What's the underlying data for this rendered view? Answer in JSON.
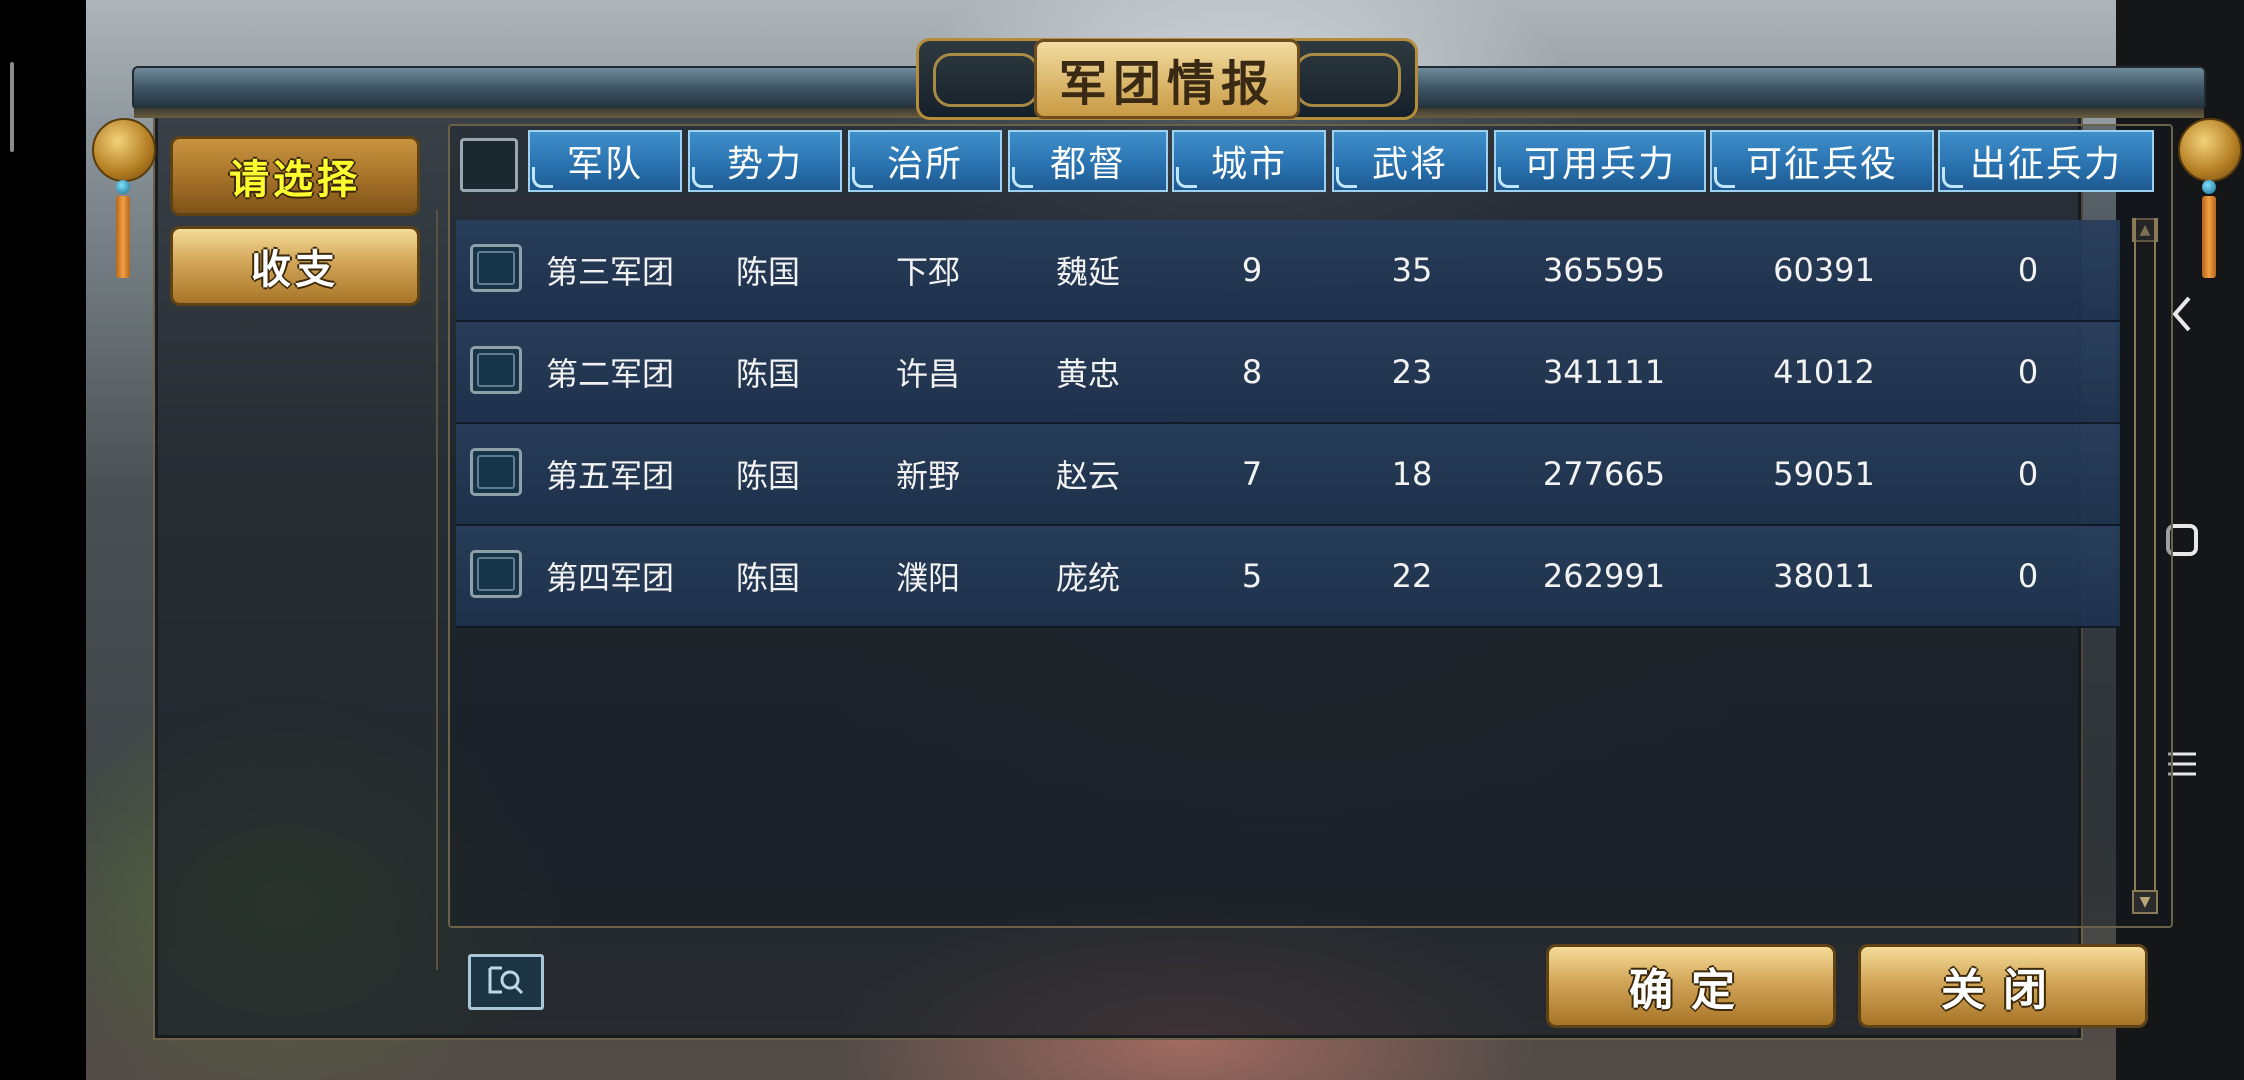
{
  "window": {
    "title": "军团情报"
  },
  "sidebar": {
    "items": [
      {
        "label": "请选择",
        "active": true
      },
      {
        "label": "收支",
        "active": false
      }
    ]
  },
  "table": {
    "columns": [
      "军队",
      "势力",
      "治所",
      "都督",
      "城市",
      "武将",
      "可用兵力",
      "可征兵役",
      "出征兵力"
    ],
    "rows": [
      {
        "army": "第三军团",
        "faction": "陈国",
        "seat": "下邳",
        "commander": "魏延",
        "cities": "9",
        "generals": "35",
        "available": "365595",
        "conscript": "60391",
        "deployed": "0"
      },
      {
        "army": "第二军团",
        "faction": "陈国",
        "seat": "许昌",
        "commander": "黄忠",
        "cities": "8",
        "generals": "23",
        "available": "341111",
        "conscript": "41012",
        "deployed": "0"
      },
      {
        "army": "第五军团",
        "faction": "陈国",
        "seat": "新野",
        "commander": "赵云",
        "cities": "7",
        "generals": "18",
        "available": "277665",
        "conscript": "59051",
        "deployed": "0"
      },
      {
        "army": "第四军团",
        "faction": "陈国",
        "seat": "濮阳",
        "commander": "庞统",
        "cities": "5",
        "generals": "22",
        "available": "262991",
        "conscript": "38011",
        "deployed": "0"
      }
    ]
  },
  "footer": {
    "confirm_label": "确定",
    "close_label": "关闭"
  },
  "icons": {
    "search": "search-icon",
    "back": "back-icon",
    "home": "home-icon",
    "menu": "menu-icon"
  },
  "colors": {
    "header_blue": "#2a73b1",
    "gold": "#d2a558",
    "active_text": "#ffff30"
  }
}
